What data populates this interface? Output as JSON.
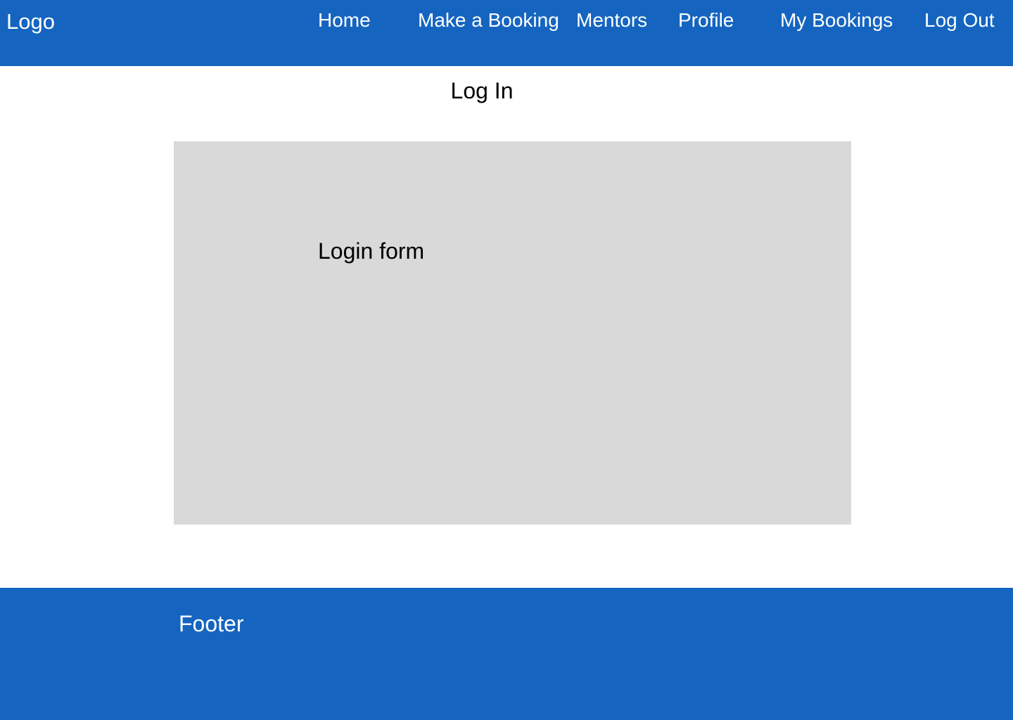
{
  "header": {
    "logo": "Logo",
    "nav": [
      {
        "label": "Home"
      },
      {
        "label": "Make a Booking"
      },
      {
        "label": "Mentors"
      },
      {
        "label": "Profile"
      },
      {
        "label": "My Bookings"
      },
      {
        "label": "Log Out"
      }
    ]
  },
  "main": {
    "title": "Log In",
    "placeholder_label": "Login form"
  },
  "footer": {
    "label": "Footer"
  },
  "colors": {
    "brand": "#1565c0",
    "placeholder_bg": "#d9d9d9"
  }
}
